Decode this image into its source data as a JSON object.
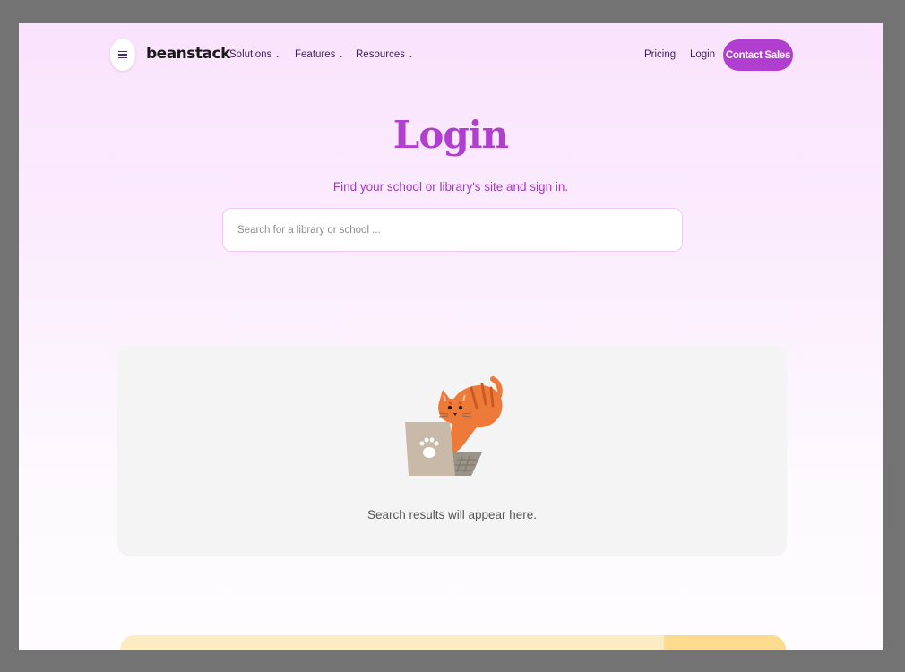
{
  "nav": {
    "menu_icon": "hamburger-icon",
    "logo": "beanstack",
    "links": [
      {
        "label": "Solutions",
        "icon": "chevron-down-icon"
      },
      {
        "label": "Features",
        "icon": "chevron-down-icon"
      },
      {
        "label": "Resources",
        "icon": "chevron-down-icon"
      }
    ],
    "pricing": "Pricing",
    "login": "Login",
    "contact": "Contact Sales"
  },
  "hero": {
    "title": "Login",
    "subtitle": "Find your school or library's site and sign in.",
    "search_placeholder": "Search for a library or school ...",
    "search_value": ""
  },
  "results": {
    "illustration": "cat-on-laptop-illustration",
    "empty_text": "Search results will appear here."
  },
  "colors": {
    "accent": "#b03fcf",
    "nav_text": "#3d1f5c",
    "panel": "#f4f4f4",
    "banner": "#fcecc4"
  }
}
